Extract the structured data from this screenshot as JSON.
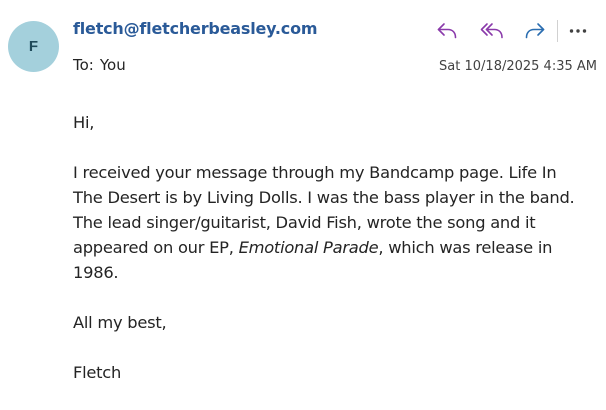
{
  "sender": {
    "initial": "F",
    "email": "fletch@fletcherbeasley.com"
  },
  "recipient": {
    "label": "To:",
    "value": "You"
  },
  "timestamp": "Sat 10/18/2025 4:35 AM",
  "actions": {
    "reply_icon": "reply-icon",
    "reply_all_icon": "reply-all-icon",
    "forward_icon": "forward-icon",
    "more_icon": "more-icon",
    "accent_purple": "#8a3aaa",
    "accent_blue": "#2a6db0"
  },
  "message": {
    "greeting": "Hi,",
    "paragraph": {
      "line1": "I received your message through my Bandcamp page. Life In",
      "line2": "The Desert is by Living Dolls. I was the bass player in the band.",
      "line3": "The lead singer/guitarist, David Fish, wrote the song and it",
      "line4_before": "appeared on our EP, ",
      "line4_title": "Emotional Parade",
      "line4_after": ", which was release in",
      "line5": "1986."
    },
    "closing": "All my best,",
    "signature": "Fletch"
  },
  "colors": {
    "avatar_bg": "#a4d0dc",
    "sender_link": "#2a5a98",
    "text": "#242424"
  }
}
